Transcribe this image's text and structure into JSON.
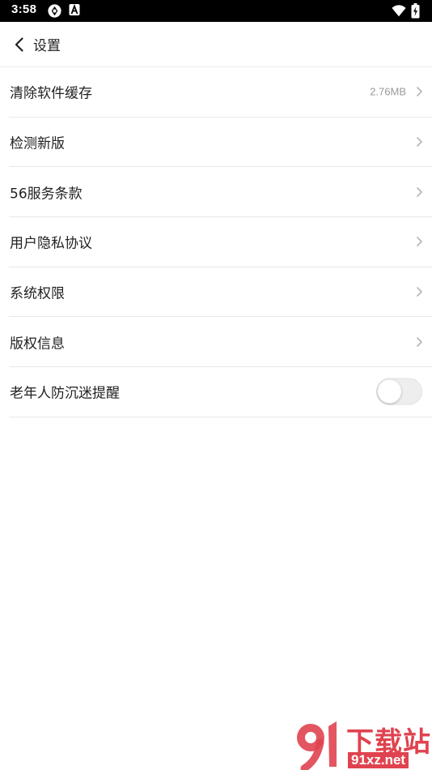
{
  "status_bar": {
    "time": "3:58",
    "icons": [
      "sync-icon",
      "a-badge-icon",
      "wifi-icon",
      "battery-charging-icon"
    ]
  },
  "header": {
    "title": "设置",
    "back_icon": "chevron-left-icon"
  },
  "settings": {
    "items": [
      {
        "label": "清除软件缓存",
        "value": "2.76MB",
        "accessory": "chevron-right-icon"
      },
      {
        "label": "检测新版",
        "accessory": "chevron-right-icon"
      },
      {
        "label": "56服务条款",
        "accessory": "chevron-right-icon"
      },
      {
        "label": "用户隐私协议",
        "accessory": "chevron-right-icon"
      },
      {
        "label": "系统权限",
        "accessory": "chevron-right-icon"
      },
      {
        "label": "版权信息",
        "accessory": "chevron-right-icon"
      },
      {
        "label": "老年人防沉迷提醒",
        "accessory": "toggle",
        "toggle_on": false
      }
    ]
  },
  "watermark": {
    "title": "下载站",
    "url": "91xz.net",
    "color": "#e0434f"
  }
}
